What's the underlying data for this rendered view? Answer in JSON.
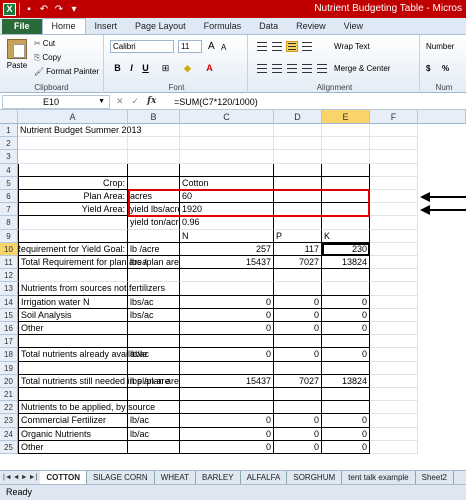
{
  "window": {
    "title": "Nutrient Budgeting Table - Micros",
    "app_icon": "X"
  },
  "ribbon_tabs": [
    "File",
    "Home",
    "Insert",
    "Page Layout",
    "Formulas",
    "Data",
    "Review",
    "View"
  ],
  "clipboard": {
    "paste": "Paste",
    "cut": "Cut",
    "copy": "Copy",
    "format_painter": "Format Painter",
    "label": "Clipboard"
  },
  "font": {
    "name": "Calibri",
    "size": "11",
    "bold": "B",
    "italic": "I",
    "underline": "U",
    "grow": "A",
    "shrink": "A",
    "color_a": "A",
    "label": "Font"
  },
  "alignment": {
    "wrap": "Wrap Text",
    "merge": "Merge & Center",
    "label": "Alignment"
  },
  "number": {
    "format": "Number",
    "currency": "$",
    "percent": "%",
    "label": "Num"
  },
  "formula_bar": {
    "cell_ref": "E10",
    "fx": "fx",
    "formula": "=SUM(C7*120/1000)"
  },
  "columns": [
    "A",
    "B",
    "C",
    "D",
    "E",
    "F"
  ],
  "rows": [
    "1",
    "2",
    "3",
    "4",
    "5",
    "6",
    "7",
    "8",
    "9",
    "10",
    "11",
    "12",
    "13",
    "14",
    "15",
    "16",
    "17",
    "18",
    "19",
    "20",
    "21",
    "22",
    "23",
    "24",
    "25"
  ],
  "cells": {
    "r1": {
      "a": "Nutrient Budget Summer 2013"
    },
    "r5": {
      "a": "Crop:",
      "c": "Cotton"
    },
    "r6": {
      "a": "Plan Area:",
      "b": "acres",
      "c": "60"
    },
    "r7": {
      "a": "Yield Area:",
      "b": "yield lbs/acre",
      "c": "1920"
    },
    "r8": {
      "b": "yield ton/acre",
      "c": "0.96"
    },
    "r9": {
      "c": "N",
      "d": "P",
      "e": "K"
    },
    "r10": {
      "a": "Requirement for Yield Goal:",
      "b": "lb /acre",
      "c": "257",
      "d": "117",
      "e": "230"
    },
    "r11": {
      "a": "Total Requirement for plan area",
      "b": "lbs /plan area",
      "c": "15437",
      "d": "7027",
      "e": "13824"
    },
    "r13": {
      "a": "Nutrients from sources not fertilizers"
    },
    "r14": {
      "a": "Irrigation water N",
      "b": "lbs/ac",
      "c": "0",
      "d": "0",
      "e": "0"
    },
    "r15": {
      "a": "Soil Analysis",
      "b": "lbs/ac",
      "c": "0",
      "d": "0",
      "e": "0"
    },
    "r16": {
      "a": "Other",
      "c": "0",
      "d": "0",
      "e": "0"
    },
    "r18": {
      "a": "Total nutrients already available",
      "b": "lb/ac",
      "c": "0",
      "d": "0",
      "e": "0"
    },
    "r20": {
      "a": "Total nutrients still needed in plan are",
      "b": "lbs /plan area",
      "c": "15437",
      "d": "7027",
      "e": "13824"
    },
    "r22": {
      "a": "Nutrients to be applied, by source"
    },
    "r23": {
      "a": "Commercial Fertilizer",
      "b": "lb/ac",
      "c": "0",
      "d": "0",
      "e": "0"
    },
    "r24": {
      "a": "Organic Nutrients",
      "b": "lb/ac",
      "c": "0",
      "d": "0",
      "e": "0"
    },
    "r25": {
      "a": "Other",
      "c": "0",
      "d": "0",
      "e": "0"
    }
  },
  "sheet_tabs": [
    "COTTON",
    "SILAGE CORN",
    "WHEAT",
    "BARLEY",
    "ALFALFA",
    "SORGHUM",
    "tent talk example",
    "Sheet2"
  ],
  "status": "Ready",
  "colors": {
    "titlebar": "#c00000",
    "file_tab": "#2a6a38",
    "highlight": "#e00000",
    "selected_header": "#f8d46b"
  }
}
